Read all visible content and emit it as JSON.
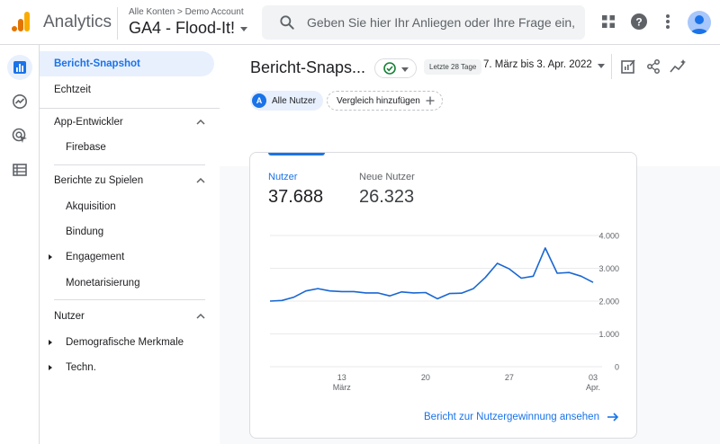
{
  "app": {
    "name": "Analytics",
    "breadcrumb_all": "Alle Konten",
    "breadcrumb_account": "Demo Account",
    "property": "GA4 - Flood-It!"
  },
  "search": {
    "placeholder": "Geben Sie hier Ihr Anliegen oder Ihre Frage ein, z..."
  },
  "rail": [
    "reports-icon",
    "explore-icon",
    "advertising-icon",
    "configure-icon"
  ],
  "nav": {
    "items": [
      {
        "label": "Bericht-Snapshot"
      },
      {
        "label": "Echtzeit"
      },
      {
        "label": "App-Entwickler"
      },
      {
        "label": "Firebase"
      },
      {
        "label": "Berichte zu Spielen"
      },
      {
        "label": "Akquisition"
      },
      {
        "label": "Bindung"
      },
      {
        "label": "Engagement"
      },
      {
        "label": "Monetarisierung"
      },
      {
        "label": "Nutzer"
      },
      {
        "label": "Demografische Merkmale"
      },
      {
        "label": "Techn."
      }
    ]
  },
  "header": {
    "title": "Bericht-Snaps...",
    "range_badge": "Letzte 28 Tage",
    "date_range": "7. März bis 3. Apr. 2022"
  },
  "chips": {
    "all_users_badge": "A",
    "all_users": "Alle Nutzer",
    "compare": "Vergleich hinzufügen"
  },
  "card": {
    "metric1_label": "Nutzer",
    "metric1_value": "37.688",
    "metric2_label": "Neue Nutzer",
    "metric2_value": "26.323",
    "link": "Bericht zur Nutzergewinnung ansehen"
  },
  "colors": {
    "accent": "#1a73e8",
    "line": "#1967d2"
  },
  "chart_data": {
    "type": "line",
    "x": [
      "7 Mär",
      "8 Mär",
      "9 Mär",
      "10 Mär",
      "11 Mär",
      "12 Mär",
      "13 Mär",
      "14 Mär",
      "15 Mär",
      "16 Mär",
      "17 Mär",
      "18 Mär",
      "19 Mär",
      "20 Mär",
      "21 Mär",
      "22 Mär",
      "23 Mär",
      "24 Mär",
      "25 Mär",
      "26 Mär",
      "27 Mär",
      "28 Mär",
      "29 Mär",
      "30 Mär",
      "31 Mär",
      "1 Apr",
      "2 Apr",
      "3 Apr"
    ],
    "series": [
      {
        "values": [
          2000,
          2020,
          2120,
          2310,
          2380,
          2310,
          2290,
          2290,
          2250,
          2250,
          2160,
          2280,
          2250,
          2260,
          2070,
          2230,
          2240,
          2380,
          2720,
          3150,
          2980,
          2700,
          2760,
          3620,
          2850,
          2870,
          2760,
          2570
        ]
      }
    ],
    "x_ticks": [
      {
        "label": "13",
        "sub": "März"
      },
      {
        "label": "20",
        "sub": ""
      },
      {
        "label": "27",
        "sub": ""
      },
      {
        "label": "03",
        "sub": "Apr."
      }
    ],
    "y_ticks": [
      "4.000",
      "3.000",
      "2.000",
      "1.000",
      "0"
    ],
    "ylim": [
      0,
      4000
    ],
    "grid": true
  }
}
